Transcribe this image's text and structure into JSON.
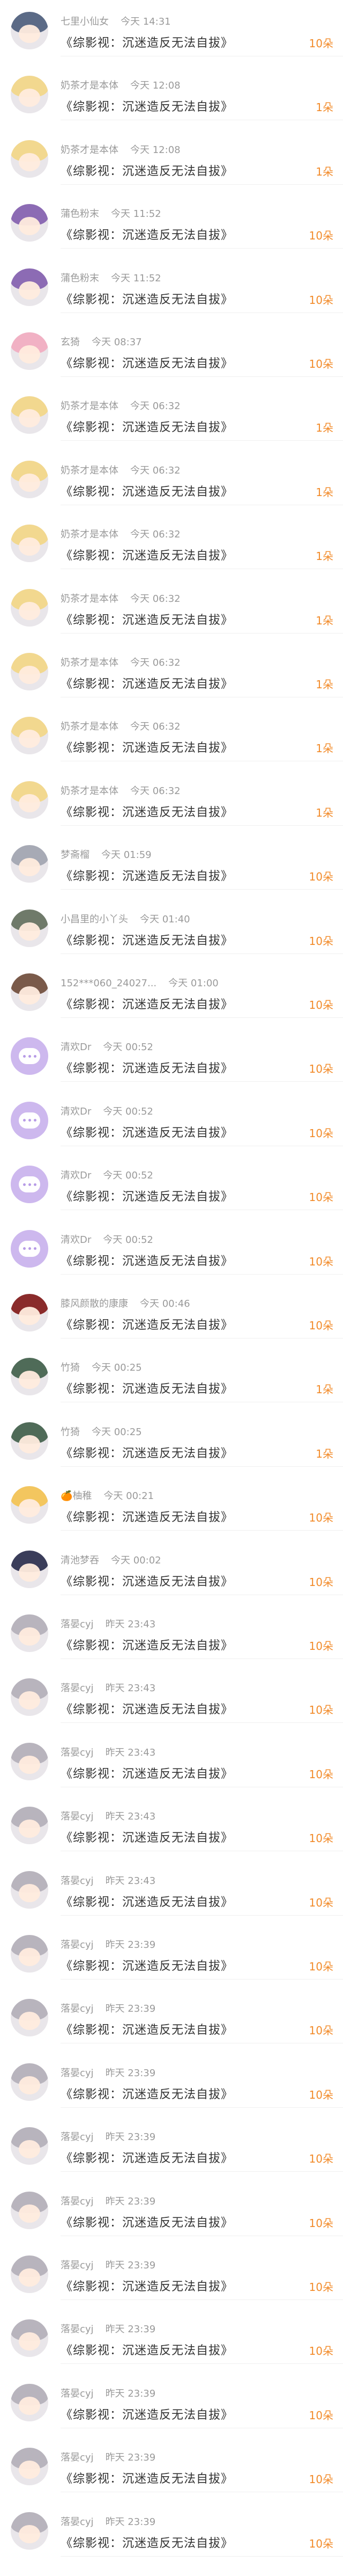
{
  "gift_list": {
    "rows": [
      {
        "user": "七里小仙女",
        "time": "今天 14:31",
        "book": "《综影视：沉迷造反无法自拔》",
        "amount": "10朵",
        "avatar": "dark-anime-avatar",
        "color": "#5b6a86"
      },
      {
        "user": "奶茶才是本体",
        "time": "今天 12:08",
        "book": "《综影视：沉迷造反无法自拔》",
        "amount": "1朵",
        "avatar": "blonde-girl-avatar",
        "color": "#f2d88f"
      },
      {
        "user": "奶茶才是本体",
        "time": "今天 12:08",
        "book": "《综影视：沉迷造反无法自拔》",
        "amount": "1朵",
        "avatar": "blonde-girl-avatar",
        "color": "#f2d88f"
      },
      {
        "user": "蒲色粉末",
        "time": "今天 11:52",
        "book": "《综影视：沉迷造反无法自拔》",
        "amount": "10朵",
        "avatar": "purple-hair-avatar",
        "color": "#8c6bb4"
      },
      {
        "user": "蒲色粉末",
        "time": "今天 11:52",
        "book": "《综影视：沉迷造反无法自拔》",
        "amount": "10朵",
        "avatar": "purple-hair-avatar",
        "color": "#8c6bb4"
      },
      {
        "user": "玄猗",
        "time": "今天 08:37",
        "book": "《综影视：沉迷造反无法自拔》",
        "amount": "10朵",
        "avatar": "pink-hair-avatar",
        "color": "#f1b1c4"
      },
      {
        "user": "奶茶才是本体",
        "time": "今天 06:32",
        "book": "《综影视：沉迷造反无法自拔》",
        "amount": "1朵",
        "avatar": "blonde-girl-avatar",
        "color": "#f2d88f"
      },
      {
        "user": "奶茶才是本体",
        "time": "今天 06:32",
        "book": "《综影视：沉迷造反无法自拔》",
        "amount": "1朵",
        "avatar": "blonde-girl-avatar",
        "color": "#f2d88f"
      },
      {
        "user": "奶茶才是本体",
        "time": "今天 06:32",
        "book": "《综影视：沉迷造反无法自拔》",
        "amount": "1朵",
        "avatar": "blonde-girl-avatar",
        "color": "#f2d88f"
      },
      {
        "user": "奶茶才是本体",
        "time": "今天 06:32",
        "book": "《综影视：沉迷造反无法自拔》",
        "amount": "1朵",
        "avatar": "blonde-girl-avatar",
        "color": "#f2d88f"
      },
      {
        "user": "奶茶才是本体",
        "time": "今天 06:32",
        "book": "《综影视：沉迷造反无法自拔》",
        "amount": "1朵",
        "avatar": "blonde-girl-avatar",
        "color": "#f2d88f"
      },
      {
        "user": "奶茶才是本体",
        "time": "今天 06:32",
        "book": "《综影视：沉迷造反无法自拔》",
        "amount": "1朵",
        "avatar": "blonde-girl-avatar",
        "color": "#f2d88f"
      },
      {
        "user": "奶茶才是本体",
        "time": "今天 06:32",
        "book": "《综影视：沉迷造反无法自拔》",
        "amount": "1朵",
        "avatar": "blonde-girl-avatar",
        "color": "#f2d88f"
      },
      {
        "user": "梦斋榴",
        "time": "今天 01:59",
        "book": "《综影视：沉迷造反无法自拔》",
        "amount": "10朵",
        "avatar": "grey-hair-avatar",
        "color": "#a7aab5"
      },
      {
        "user": "小昌里的小丫头",
        "time": "今天 01:40",
        "book": "《综影视：沉迷造反无法自拔》",
        "amount": "10朵",
        "avatar": "chibi-avatar",
        "color": "#6f7a6a"
      },
      {
        "user": "152***060_24027...",
        "time": "今天 01:00",
        "book": "《综影视：沉迷造反无法自拔》",
        "amount": "10朵",
        "avatar": "photo-avatar",
        "color": "#7a5a4a"
      },
      {
        "user": "清欢Dr",
        "time": "今天 00:52",
        "book": "《综影视：沉迷造反无法自拔》",
        "amount": "10朵",
        "avatar": "chat-bubble-avatar",
        "color": "#cdb8ee"
      },
      {
        "user": "清欢Dr",
        "time": "今天 00:52",
        "book": "《综影视：沉迷造反无法自拔》",
        "amount": "10朵",
        "avatar": "chat-bubble-avatar",
        "color": "#cdb8ee"
      },
      {
        "user": "清欢Dr",
        "time": "今天 00:52",
        "book": "《综影视：沉迷造反无法自拔》",
        "amount": "10朵",
        "avatar": "chat-bubble-avatar",
        "color": "#cdb8ee"
      },
      {
        "user": "清欢Dr",
        "time": "今天 00:52",
        "book": "《综影视：沉迷造反无法自拔》",
        "amount": "10朵",
        "avatar": "chat-bubble-avatar",
        "color": "#cdb8ee"
      },
      {
        "user": "膝风颜散的康康",
        "time": "今天 00:46",
        "book": "《综影视：沉迷造反无法自拔》",
        "amount": "10朵",
        "avatar": "red-outfit-avatar",
        "color": "#8a2b2b"
      },
      {
        "user": "竹猗",
        "time": "今天 00:25",
        "book": "《综影视：沉迷造反无法自拔》",
        "amount": "1朵",
        "avatar": "green-avatar",
        "color": "#4f6b58"
      },
      {
        "user": "竹猗",
        "time": "今天 00:25",
        "book": "《综影视：沉迷造反无法自拔》",
        "amount": "1朵",
        "avatar": "green-avatar",
        "color": "#4f6b58"
      },
      {
        "user": "🍊柚稚",
        "time": "今天 00:21",
        "book": "《综影视：沉迷造反无法自拔》",
        "amount": "10朵",
        "avatar": "cartoon-avatar",
        "color": "#f3c65f"
      },
      {
        "user": "清池梦吞",
        "time": "今天 00:02",
        "book": "《综影视：沉迷造反无法自拔》",
        "amount": "10朵",
        "avatar": "night-avatar",
        "color": "#3a3d5a"
      },
      {
        "user": "落晏cyj",
        "time": "昨天 23:43",
        "book": "《综影视：沉迷造反无法自拔》",
        "amount": "10朵",
        "avatar": "white-hair-avatar",
        "color": "#b8b4bd"
      },
      {
        "user": "落晏cyj",
        "time": "昨天 23:43",
        "book": "《综影视：沉迷造反无法自拔》",
        "amount": "10朵",
        "avatar": "white-hair-avatar",
        "color": "#b8b4bd"
      },
      {
        "user": "落晏cyj",
        "time": "昨天 23:43",
        "book": "《综影视：沉迷造反无法自拔》",
        "amount": "10朵",
        "avatar": "white-hair-avatar",
        "color": "#b8b4bd"
      },
      {
        "user": "落晏cyj",
        "time": "昨天 23:43",
        "book": "《综影视：沉迷造反无法自拔》",
        "amount": "10朵",
        "avatar": "white-hair-avatar",
        "color": "#b8b4bd"
      },
      {
        "user": "落晏cyj",
        "time": "昨天 23:43",
        "book": "《综影视：沉迷造反无法自拔》",
        "amount": "10朵",
        "avatar": "white-hair-avatar",
        "color": "#b8b4bd"
      },
      {
        "user": "落晏cyj",
        "time": "昨天 23:39",
        "book": "《综影视：沉迷造反无法自拔》",
        "amount": "10朵",
        "avatar": "white-hair-avatar",
        "color": "#b8b4bd"
      },
      {
        "user": "落晏cyj",
        "time": "昨天 23:39",
        "book": "《综影视：沉迷造反无法自拔》",
        "amount": "10朵",
        "avatar": "white-hair-avatar",
        "color": "#b8b4bd"
      },
      {
        "user": "落晏cyj",
        "time": "昨天 23:39",
        "book": "《综影视：沉迷造反无法自拔》",
        "amount": "10朵",
        "avatar": "white-hair-avatar",
        "color": "#b8b4bd"
      },
      {
        "user": "落晏cyj",
        "time": "昨天 23:39",
        "book": "《综影视：沉迷造反无法自拔》",
        "amount": "10朵",
        "avatar": "white-hair-avatar",
        "color": "#b8b4bd"
      },
      {
        "user": "落晏cyj",
        "time": "昨天 23:39",
        "book": "《综影视：沉迷造反无法自拔》",
        "amount": "10朵",
        "avatar": "white-hair-avatar",
        "color": "#b8b4bd"
      },
      {
        "user": "落晏cyj",
        "time": "昨天 23:39",
        "book": "《综影视：沉迷造反无法自拔》",
        "amount": "10朵",
        "avatar": "white-hair-avatar",
        "color": "#b8b4bd"
      },
      {
        "user": "落晏cyj",
        "time": "昨天 23:39",
        "book": "《综影视：沉迷造反无法自拔》",
        "amount": "10朵",
        "avatar": "white-hair-avatar",
        "color": "#b8b4bd"
      },
      {
        "user": "落晏cyj",
        "time": "昨天 23:39",
        "book": "《综影视：沉迷造反无法自拔》",
        "amount": "10朵",
        "avatar": "white-hair-avatar",
        "color": "#b8b4bd"
      },
      {
        "user": "落晏cyj",
        "time": "昨天 23:39",
        "book": "《综影视：沉迷造反无法自拔》",
        "amount": "10朵",
        "avatar": "white-hair-avatar",
        "color": "#b8b4bd"
      },
      {
        "user": "落晏cyj",
        "time": "昨天 23:39",
        "book": "《综影视：沉迷造反无法自拔》",
        "amount": "10朵",
        "avatar": "white-hair-avatar",
        "color": "#b8b4bd"
      }
    ]
  }
}
